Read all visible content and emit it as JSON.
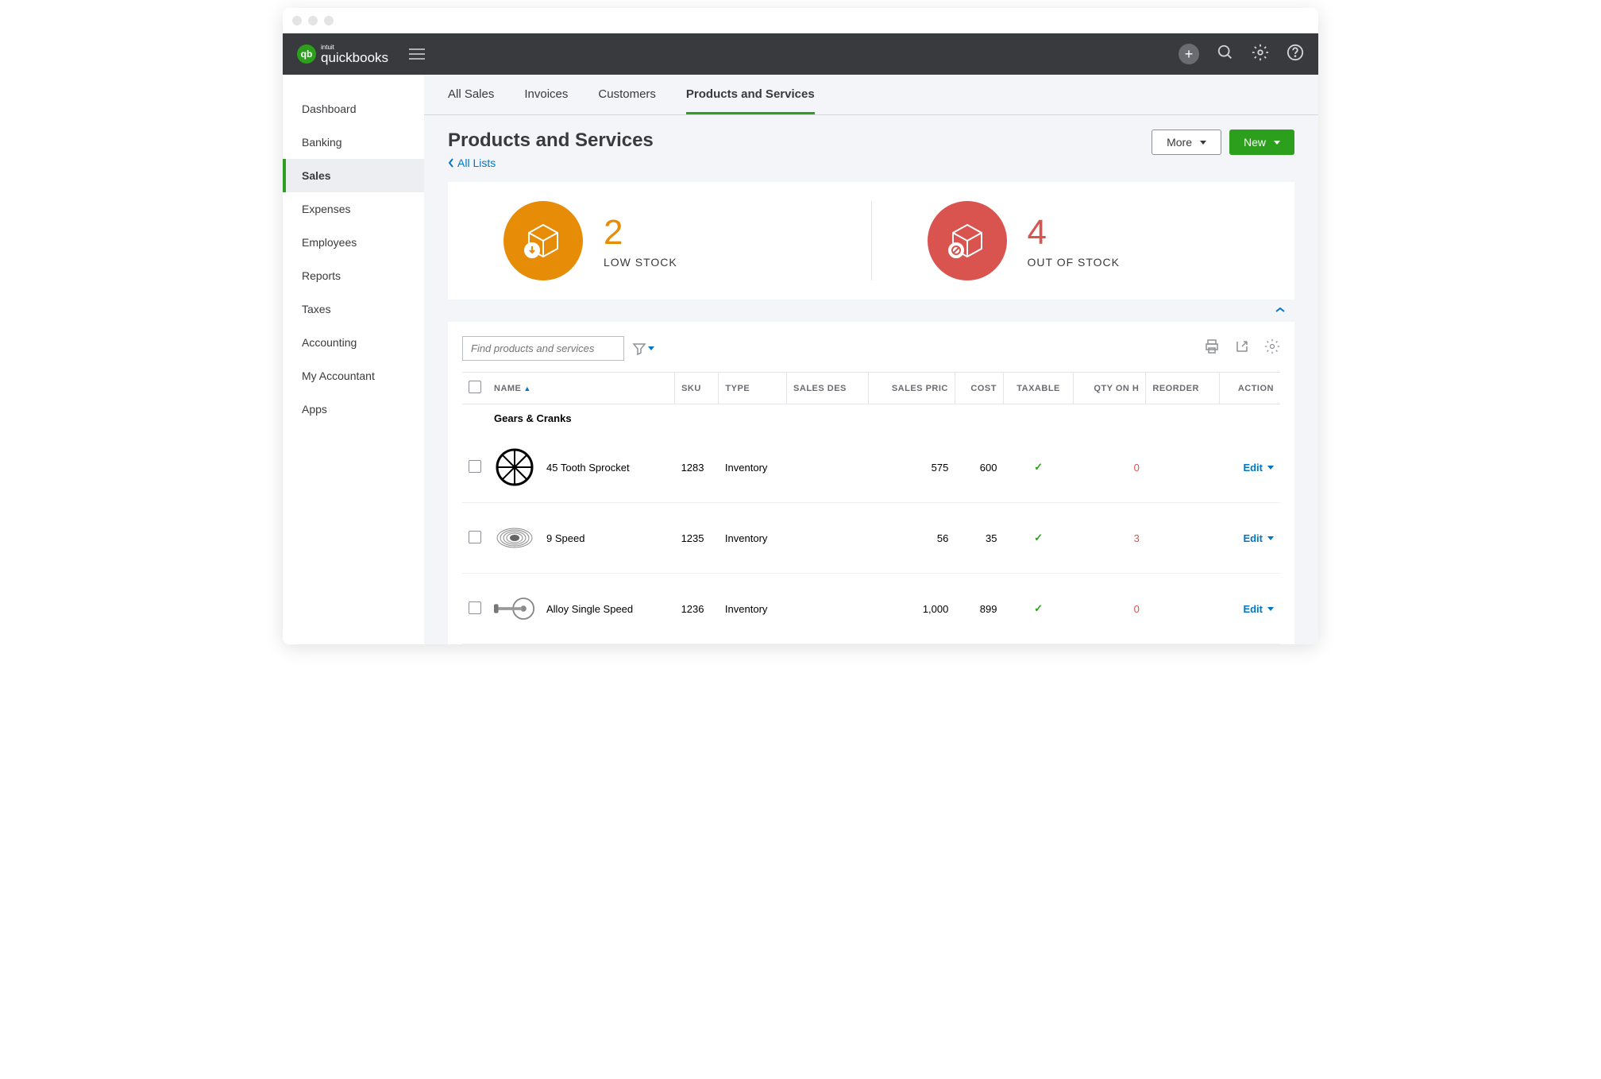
{
  "logo": {
    "small": "intuit",
    "big": "quickbooks"
  },
  "sidebar": {
    "items": [
      "Dashboard",
      "Banking",
      "Sales",
      "Expenses",
      "Employees",
      "Reports",
      "Taxes",
      "Accounting",
      "My Accountant",
      "Apps"
    ],
    "active_index": 2
  },
  "tabs": {
    "items": [
      "All Sales",
      "Invoices",
      "Customers",
      "Products and Services"
    ],
    "active_index": 3
  },
  "page": {
    "title": "Products and Services",
    "back_link": "All Lists",
    "more_button": "More",
    "new_button": "New"
  },
  "stock": {
    "low": {
      "count": "2",
      "label": "LOW STOCK"
    },
    "out": {
      "count": "4",
      "label": "OUT OF STOCK"
    }
  },
  "search": {
    "placeholder": "Find products and services"
  },
  "table": {
    "headers": {
      "name": "NAME",
      "sku": "SKU",
      "type": "TYPE",
      "sales_desc": "SALES DES",
      "sales_price": "SALES PRIC",
      "cost": "COST",
      "taxable": "TAXABLE",
      "qty": "QTY ON H",
      "reorder": "REORDER",
      "action": "ACTION"
    },
    "category": "Gears & Cranks",
    "rows": [
      {
        "name": "45 Tooth Sprocket",
        "sku": "1283",
        "type": "Inventory",
        "sales_price": "575",
        "cost": "600",
        "taxable": true,
        "qty": "0",
        "action": "Edit"
      },
      {
        "name": "9 Speed",
        "sku": "1235",
        "type": "Inventory",
        "sales_price": "56",
        "cost": "35",
        "taxable": true,
        "qty": "3",
        "action": "Edit"
      },
      {
        "name": "Alloy Single Speed",
        "sku": "1236",
        "type": "Inventory",
        "sales_price": "1,000",
        "cost": "899",
        "taxable": true,
        "qty": "0",
        "action": "Edit"
      }
    ]
  }
}
